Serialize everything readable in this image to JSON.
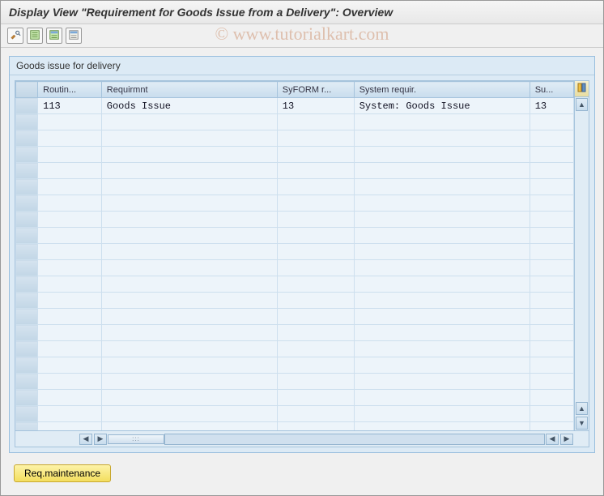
{
  "title": "Display View \"Requirement for Goods Issue from a Delivery\": Overview",
  "toolbar": {
    "buttons": [
      {
        "name": "toggle-edit",
        "icon": "pencil-glasses"
      },
      {
        "name": "select-all",
        "icon": "sheet-green"
      },
      {
        "name": "deselect-all",
        "icon": "sheet-blue"
      },
      {
        "name": "detail",
        "icon": "sheet-plain"
      }
    ]
  },
  "panel": {
    "title": "Goods issue for delivery"
  },
  "table": {
    "columns": [
      "Routin...",
      "Requirmnt",
      "SyFORM r...",
      "System requir.",
      "Su..."
    ],
    "rows": [
      {
        "routine": "113",
        "requirement": "Goods Issue",
        "syform": "13",
        "sysreq": "System: Goods Issue",
        "su": "13"
      }
    ],
    "empty_row_count": 20
  },
  "footer_button": "Req.maintenance",
  "watermark": "© www.tutorialkart.com"
}
